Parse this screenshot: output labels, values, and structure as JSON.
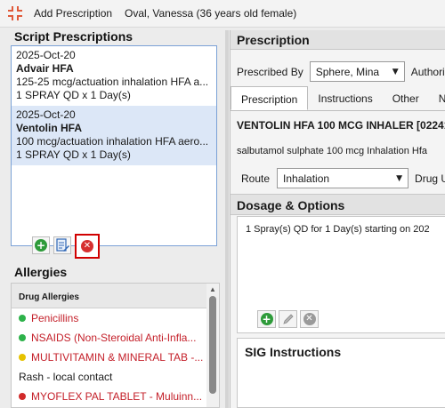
{
  "window": {
    "title": "Add Prescription",
    "patient": "Oval, Vanessa (36 years old female)"
  },
  "script_prescriptions": {
    "heading": "Script Prescriptions",
    "items": [
      {
        "date": "2025-Oct-20",
        "name": "Advair HFA",
        "detail": "125-25 mcg/actuation inhalation HFA a...",
        "dose": "1 SPRAY QD x 1 Day(s)",
        "selected": false
      },
      {
        "date": "2025-Oct-20",
        "name": "Ventolin HFA",
        "detail": "100 mcg/actuation inhalation HFA aero...",
        "dose": "1 SPRAY QD x 1 Day(s)",
        "selected": true
      }
    ],
    "buttons": {
      "add_icon": "plus-circle-icon",
      "edit_icon": "edit-note-icon",
      "delete_icon": "x-circle-icon"
    }
  },
  "allergies": {
    "heading": "Allergies",
    "column": "Drug Allergies",
    "rows": [
      {
        "text": "Penicillins",
        "dot": "#2db24a",
        "red_text": true
      },
      {
        "text": "NSAIDS (Non-Steroidal Anti-Infla...",
        "dot": "#2db24a",
        "red_text": true
      },
      {
        "text": "MULTIVITAMIN & MINERAL TAB -...",
        "dot": "#e6c200",
        "red_text": true
      },
      {
        "text": "Rash - local contact",
        "dot": "",
        "red_text": false
      },
      {
        "text": "MYOFLEX PAL TABLET - Muluinn...",
        "dot": "#d12a2a",
        "red_text": true
      }
    ]
  },
  "prescription": {
    "heading": "Prescription",
    "prescribed_by_label": "Prescribed By",
    "prescribed_by_value": "Sphere, Mina",
    "authority_label": "Authori",
    "tabs": [
      "Prescription",
      "Instructions",
      "Other",
      "N"
    ],
    "drug_title": "VENTOLIN HFA 100 MCG INHALER [02241",
    "drug_desc": "salbutamol sulphate 100 mcg Inhalation Hfa",
    "route_label": "Route",
    "route_value": "Inhalation",
    "drug_u_label": "Drug U"
  },
  "dosage": {
    "heading": "Dosage & Options",
    "text": "1 Spray(s) QD for 1 Day(s)  starting on 202"
  },
  "sig": {
    "heading": "SIG Instructions"
  },
  "colors": {
    "accent_blue": "#7aa1d6",
    "selected_bg": "#dce7f7",
    "delete_highlight": "#d10000",
    "allergy_red": "#c4202a"
  }
}
